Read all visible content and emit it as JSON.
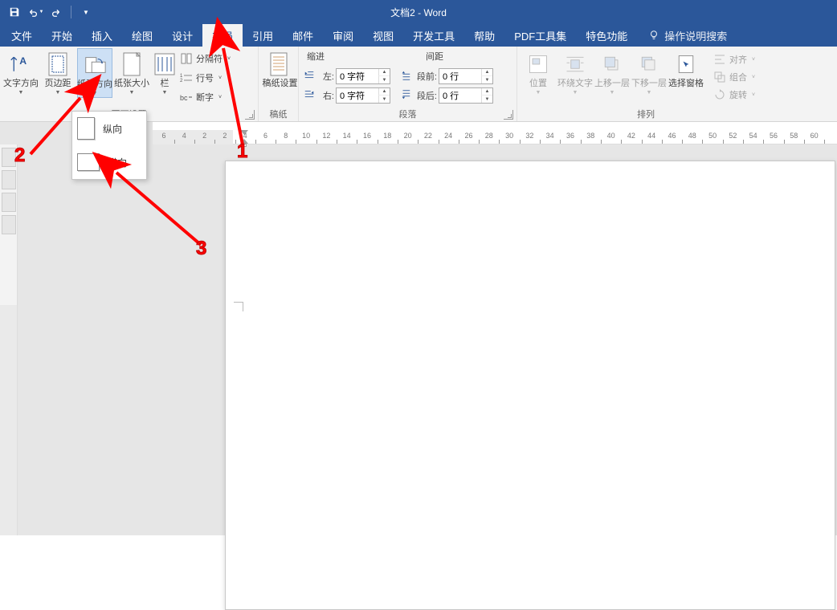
{
  "title": "文档2 - Word",
  "qat": {
    "save": "save",
    "undo": "undo",
    "redo": "redo"
  },
  "tabs": [
    "文件",
    "开始",
    "插入",
    "绘图",
    "设计",
    "布局",
    "引用",
    "邮件",
    "审阅",
    "视图",
    "开发工具",
    "帮助",
    "PDF工具集",
    "特色功能"
  ],
  "active_tab_index": 5,
  "tell_me": "操作说明搜索",
  "ribbon": {
    "page_setup": {
      "text_direction": "文字方向",
      "margins": "页边距",
      "orientation": "纸张方向",
      "size": "纸张大小",
      "columns": "栏",
      "breaks": "分隔符",
      "line_numbers": "行号",
      "hyphenation": "断字",
      "label": "页面设置"
    },
    "manuscript": {
      "btn": "稿纸设置",
      "label": "稿纸"
    },
    "indent": {
      "title": "缩进",
      "left_label": "左:",
      "right_label": "右:",
      "left_value": "0 字符",
      "right_value": "0 字符"
    },
    "spacing": {
      "title": "间距",
      "before_label": "段前:",
      "after_label": "段后:",
      "before_value": "0 行",
      "after_value": "0 行"
    },
    "paragraph_label": "段落",
    "arrange": {
      "position": "位置",
      "wrap": "环绕文字",
      "forward": "上移一层",
      "backward": "下移一层",
      "selection_pane": "选择窗格",
      "align": "对齐",
      "group": "组合",
      "rotate": "旋转",
      "label": "排列"
    }
  },
  "orientation_menu": {
    "portrait": "纵向",
    "landscape": "横向"
  },
  "ruler_numbers": [
    6,
    4,
    2,
    2,
    4,
    6,
    8,
    10,
    12,
    14,
    16,
    18,
    20,
    22,
    24,
    26,
    28,
    30,
    32,
    34,
    36,
    38,
    40,
    42,
    44,
    46,
    48,
    50,
    52,
    54,
    56,
    58,
    60
  ],
  "annotations": {
    "n1": "1",
    "n2": "2",
    "n3": "3"
  }
}
